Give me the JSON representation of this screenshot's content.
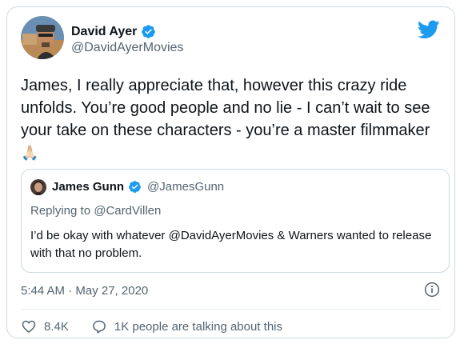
{
  "colors": {
    "brand_blue": "#1d9bf0",
    "text_primary": "#0f1419",
    "text_secondary": "#536471",
    "border": "#cfd9de"
  },
  "author": {
    "name": "David Ayer",
    "handle": "@DavidAyerMovies",
    "verified": true,
    "avatar_icon": "avatar-photo"
  },
  "brand_icon": "twitter-bird-icon",
  "tweet": {
    "text_main": "James, I really appreciate that, however this crazy ride unfolds. You’re good people and no lie - I can’t wait to see your take on these characters - you’re a master filmmaker ",
    "emoji": "🙏🏻"
  },
  "quoted_tweet": {
    "name": "James Gunn",
    "handle": "@JamesGunn",
    "verified": true,
    "replying_to": "Replying to @CardVillen",
    "text": "I’d be okay with whatever @DavidAyerMovies & Warners wanted to release with that no problem."
  },
  "timestamp": "5:44 AM · May 27, 2020",
  "info_icon": "info-icon",
  "actions": {
    "likes": "8.4K",
    "talking": "1K people are talking about this"
  }
}
